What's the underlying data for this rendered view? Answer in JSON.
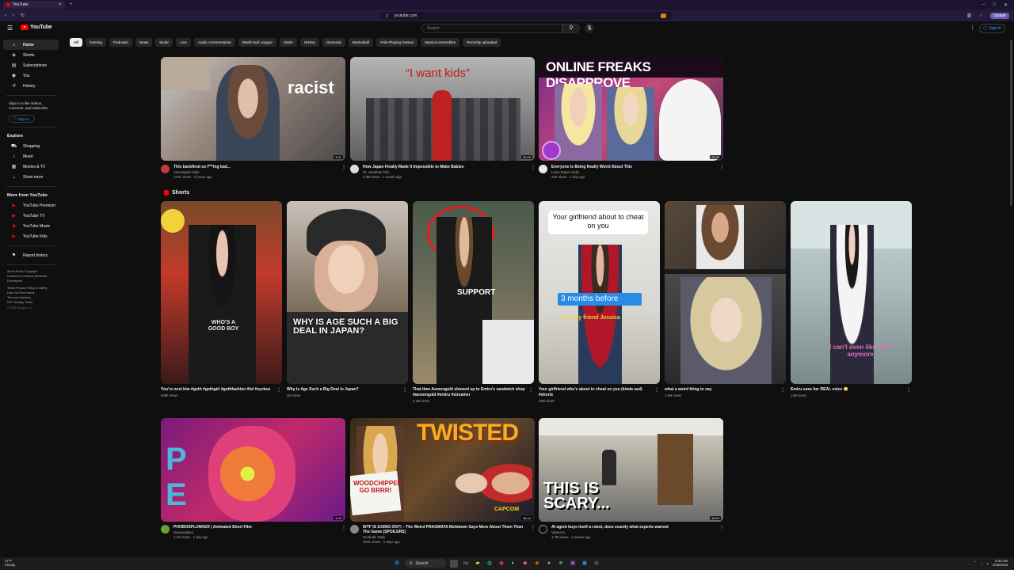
{
  "browser": {
    "tab_title": "YouTube",
    "url": "youtube.com",
    "update_label": "Update"
  },
  "header": {
    "logo_text": "YouTube",
    "search_placeholder": "Search",
    "signin_label": "Sign in"
  },
  "sidebar": {
    "items": [
      {
        "label": "Home",
        "icon": "home-icon"
      },
      {
        "label": "Shorts",
        "icon": "shorts-icon"
      },
      {
        "label": "Subscriptions",
        "icon": "subscriptions-icon"
      },
      {
        "label": "You",
        "icon": "you-icon"
      },
      {
        "label": "History",
        "icon": "history-icon"
      }
    ],
    "signin_note_1": "Sign in to like videos,",
    "signin_note_2": "comment, and subscribe.",
    "signin_label": "Sign in",
    "explore_title": "Explore",
    "explore": [
      {
        "label": "Shopping"
      },
      {
        "label": "Music"
      },
      {
        "label": "Movies & TV"
      },
      {
        "label": "Show more"
      }
    ],
    "more_title": "More from YouTube",
    "more": [
      {
        "label": "YouTube Premium"
      },
      {
        "label": "YouTube TV"
      },
      {
        "label": "YouTube Music"
      },
      {
        "label": "YouTube Kids"
      }
    ],
    "report_history": "Report history",
    "footer_1": "About  Press  Copyright",
    "footer_2": "Contact us  Creators  Advertise",
    "footer_3": "Developers",
    "footer_4": "Terms  Privacy  Policy & Safety",
    "footer_5": "How YouTube works",
    "footer_6": "Test new features",
    "footer_7": "NFL Sunday Ticket",
    "copyright": "© 2025 Google LLC"
  },
  "chips": [
    "All",
    "Gaming",
    "Podcasts",
    "News",
    "Music",
    "Live",
    "Audio commentaries",
    "World Surf League",
    "Satire",
    "History",
    "Dramedy",
    "Basketball",
    "Role-Playing Games",
    "Musical ensembles",
    "Recently uploaded"
  ],
  "videos_row1": [
    {
      "title": "This backfired so f***ing bad...",
      "channel": "Asmongold Clips",
      "stats": "127K views · 2 hours ago",
      "duration": "3:37",
      "overlay": "racist"
    },
    {
      "title": "How Japan Finally Made It Impossible to Make Babies",
      "channel": "Dr. Jonathan Tein",
      "stats": "3.3M views · 1 month ago",
      "duration": "20:20",
      "overlay": "“I want kids”"
    },
    {
      "title": "Everyone Is Being Really Weird About This",
      "channel": "Lotus Eaters Daily",
      "stats": "24K views · 1 day ago",
      "duration": "20:03",
      "overlay": "ONLINE FREAKS DISAPPROVE"
    }
  ],
  "shorts": {
    "title": "Shorts",
    "items": [
      {
        "title_1": "You're next btw #goth #gothgirl #gothfashion #lol #xyzbca",
        "title_2": "",
        "views": "848K views",
        "overlay": "WHO'S A GOOD BOY"
      },
      {
        "title_1": "Why Is Age Such a Big Deal in Japan?",
        "title_2": "",
        "views": "2M views",
        "overlay": "WHY IS AGE SUCH A BIG DEAL IN JAPAN?"
      },
      {
        "title_1": "That time Asmongold showed up to Emiru's sandwich shop",
        "title_2": "#asmongold #emiru #streamer",
        "views": "6.1M views",
        "overlay": "SUPPORT"
      },
      {
        "title_1": "Your girlfriend who's about to cheat on you (kinda sad)",
        "title_2": "#shorts",
        "views": "18M views",
        "overlay": "Your girlfriend about to cheat on you",
        "overlay_2": "3 months before",
        "overlay_3": "hey my friend Jessica"
      },
      {
        "title_1": "what a weird thing to say",
        "title_2": "",
        "views": "1.8M views",
        "overlay": ""
      },
      {
        "title_1": "Emiru uses her REAL voice 😳",
        "title_2": "",
        "views": "14M views",
        "overlay": "I can't even like do it anymore"
      }
    ]
  },
  "videos_row2": [
    {
      "title": "PHOBOSPLUNKER | Animated Short Film",
      "channel": "Rowenadavs",
      "stats": "1.1K views · 1 day ago",
      "duration": "4:25",
      "overlay": "PH  ER"
    },
    {
      "title_1": "WTF IS GOING ON?! – The Weird PRAGMATA Meltdown Says More About Them Than",
      "title_2": "The Game (SPOILERS)",
      "channel": "Nerdrotic Daily",
      "stats": "204K views · 4 days ago",
      "duration": "36:44",
      "overlay": "TWISTED",
      "overlay_2": "WOODCHIPPER GO BRRR!",
      "overlay_3": "CAPCOM"
    },
    {
      "title": "AI agent buys itself a robot, does exactly what experts warned",
      "channel": "VastenAI",
      "stats": "1.7M views · 2 weeks ago",
      "duration": "16:24",
      "overlay": "THIS IS SCARY..."
    }
  ],
  "taskbar": {
    "temp": "47°F",
    "weather": "Cloudy",
    "search": "Search",
    "time": "8:40 AM",
    "date": "4/26/2026"
  },
  "colors": {
    "accent": "#ff0000",
    "link": "#3ea6ff",
    "bg": "#0f0f0f"
  }
}
